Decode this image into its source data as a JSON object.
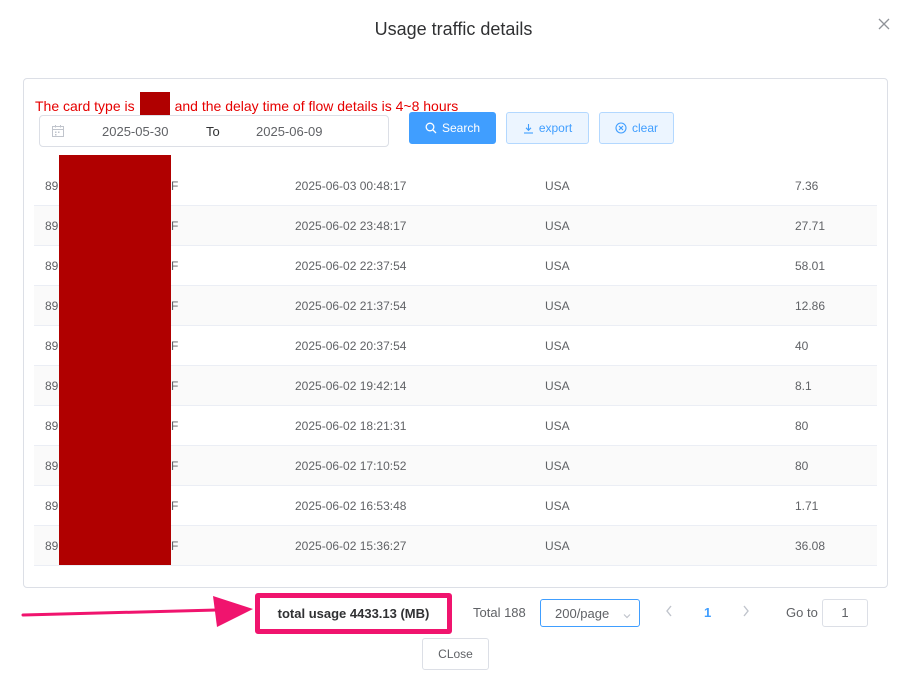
{
  "dialog": {
    "title": "Usage traffic details",
    "close_icon": "close-icon"
  },
  "notice": {
    "before": "The card type is",
    "after": "and the delay time of flow details is 4~8 hours",
    "color": "#e60000"
  },
  "filter": {
    "start_date": "2025-05-30",
    "separator": "To",
    "end_date": "2025-06-09",
    "calendar_icon": "calendar-icon"
  },
  "buttons": {
    "search": "Search",
    "export": "export",
    "clear": "clear",
    "close": "CLose"
  },
  "table": {
    "rows": [
      {
        "iccid_prefix": "89",
        "iccid_suffix": "F",
        "time": "2025-06-03 00:48:17",
        "country": "USA",
        "usage": "7.36"
      },
      {
        "iccid_prefix": "89",
        "iccid_suffix": "F",
        "time": "2025-06-02 23:48:17",
        "country": "USA",
        "usage": "27.71"
      },
      {
        "iccid_prefix": "89",
        "iccid_suffix": "F",
        "time": "2025-06-02 22:37:54",
        "country": "USA",
        "usage": "58.01"
      },
      {
        "iccid_prefix": "89",
        "iccid_suffix": "F",
        "time": "2025-06-02 21:37:54",
        "country": "USA",
        "usage": "12.86"
      },
      {
        "iccid_prefix": "89",
        "iccid_suffix": "F",
        "time": "2025-06-02 20:37:54",
        "country": "USA",
        "usage": "40"
      },
      {
        "iccid_prefix": "89",
        "iccid_suffix": "F",
        "time": "2025-06-02 19:42:14",
        "country": "USA",
        "usage": "8.1"
      },
      {
        "iccid_prefix": "89",
        "iccid_suffix": "F",
        "time": "2025-06-02 18:21:31",
        "country": "USA",
        "usage": "80"
      },
      {
        "iccid_prefix": "89",
        "iccid_suffix": "F",
        "time": "2025-06-02 17:10:52",
        "country": "USA",
        "usage": "80"
      },
      {
        "iccid_prefix": "89",
        "iccid_suffix": "F",
        "time": "2025-06-02 16:53:48",
        "country": "USA",
        "usage": "1.71"
      },
      {
        "iccid_prefix": "89",
        "iccid_suffix": "F",
        "time": "2025-06-02 15:36:27",
        "country": "USA",
        "usage": "36.08"
      }
    ]
  },
  "footer": {
    "total_usage": "total usage 4433.13 (MB)",
    "total_count": "Total 188",
    "page_size": "200/page",
    "current_page": "1",
    "goto_label": "Go to",
    "goto_value": "1"
  },
  "colors": {
    "accent": "#409eff",
    "highlight": "#f0146e",
    "redaction": "#b00000"
  }
}
